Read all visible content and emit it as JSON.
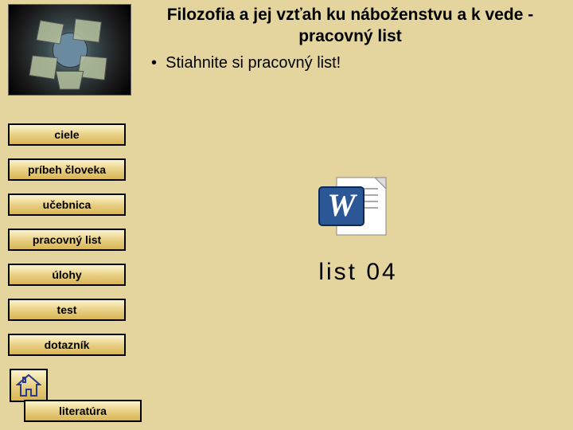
{
  "title": "Filozofia a jej vzťah ku náboženstvu a k vede - pracovný list",
  "bullet": "Stiahnite si pracovný list!",
  "nav": {
    "items": [
      {
        "label": "ciele"
      },
      {
        "label": "príbeh človeka"
      },
      {
        "label": "učebnica"
      },
      {
        "label": "pracovný list"
      },
      {
        "label": "úlohy"
      },
      {
        "label": "test"
      },
      {
        "label": "dotazník"
      }
    ],
    "literature": "literatúra"
  },
  "document": {
    "label": "list 04",
    "icon": "word-document-icon"
  },
  "home": {
    "icon": "home-icon"
  },
  "thumbnail": {
    "icon": "globe-panels-icon"
  }
}
